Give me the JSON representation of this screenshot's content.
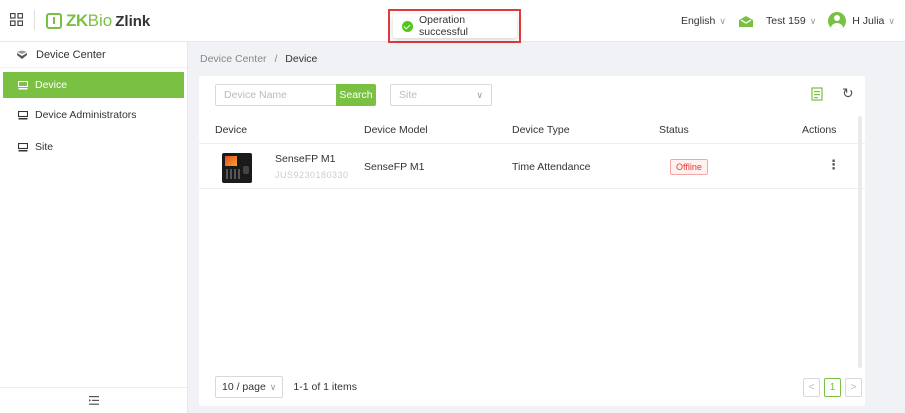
{
  "header": {
    "brand_zk": "ZK",
    "brand_bio": "Bio",
    "brand_zlink": "Zlink",
    "language": "English",
    "company": "Test 159",
    "user": "H Julia",
    "accent_color": "#7ac143"
  },
  "toast": {
    "message": "Operation successful",
    "status": "success"
  },
  "sidebar": {
    "title": "Device Center",
    "items": [
      {
        "label": "Device",
        "active": true
      },
      {
        "label": "Device Administrators",
        "active": false
      },
      {
        "label": "Site",
        "active": false
      }
    ]
  },
  "breadcrumb": {
    "parent": "Device Center",
    "separator": "/",
    "current": "Device"
  },
  "filters": {
    "search_placeholder": "Device Name",
    "search_button": "Search",
    "site_placeholder": "Site"
  },
  "table": {
    "columns": [
      "Device",
      "Device Model",
      "Device Type",
      "Status",
      "Actions"
    ],
    "rows": [
      {
        "device_name": "SenseFP M1",
        "serial": "JUS9230180330",
        "model": "SenseFP M1",
        "type": "Time Attendance",
        "status": "Offline",
        "actions": "⋮"
      }
    ]
  },
  "pagination": {
    "page_size": "10 / page",
    "summary": "1-1 of 1 items",
    "current_page": "1"
  }
}
